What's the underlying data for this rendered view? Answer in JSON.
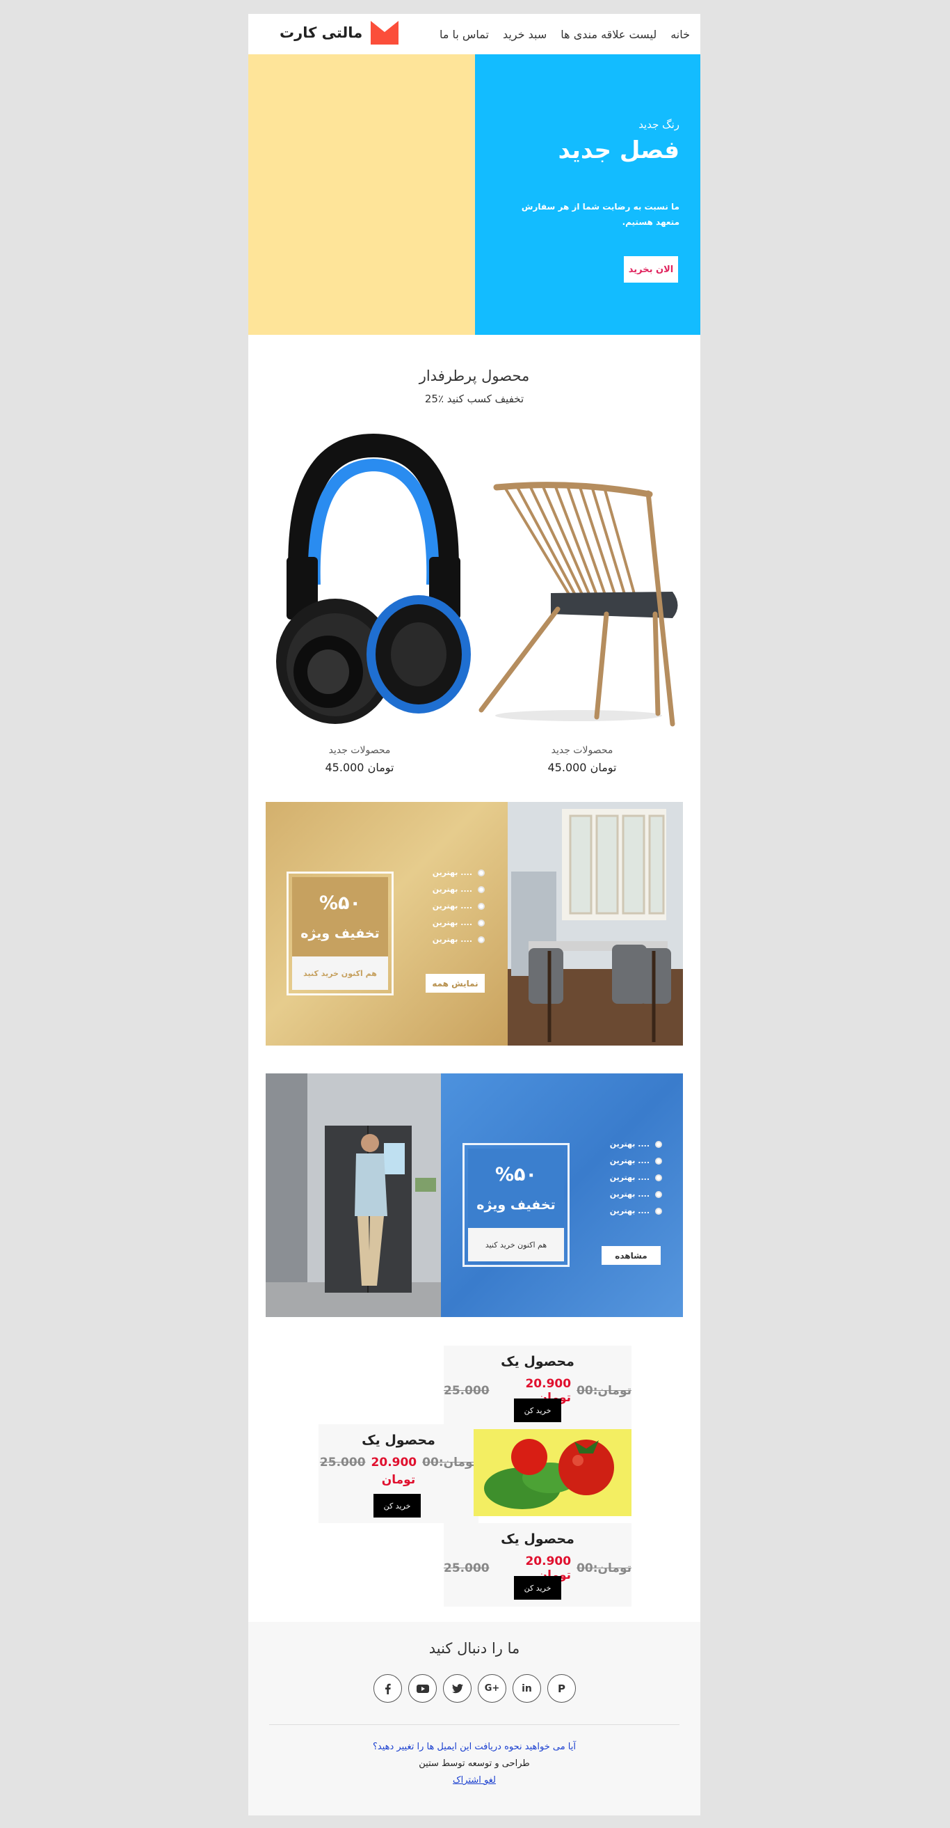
{
  "nav": {
    "items": [
      "خانه",
      "لیست علاقه مندی ها",
      "سبد خرید",
      "تماس با ما"
    ]
  },
  "brand": {
    "name": "مالتی کارت",
    "color": "#fb4e3a"
  },
  "hero": {
    "subtitle": "رنگ جدید",
    "title": "فصل جدید",
    "description": "ما نسبت به رضایت شما از هر سفارش متعهد هستیم.",
    "button": "الان بخرید",
    "left_color": "#fee499",
    "right_color": "#13bcff"
  },
  "featured": {
    "title": "محصول پرطرفدار",
    "subtitle": "25٪ تخفیف کسب کنید",
    "products": [
      {
        "image": "chair-image",
        "label": "محصولات جدید",
        "price": "45.000 تومان"
      },
      {
        "image": "headphones-image",
        "label": "محصولات جدید",
        "price": "45.000 تومان"
      }
    ]
  },
  "promo1": {
    "percent": "%۵۰",
    "off": "تخفیف ویژه",
    "cta": "هم اکنون خرید کنید",
    "bullets": [
      "بهترین ....",
      "بهترین ....",
      "بهترین ....",
      "بهترین ....",
      "بهترین ...."
    ],
    "button": "نمایش همه",
    "accent": "#c6a160"
  },
  "promo2": {
    "percent": "%۵۰",
    "off": "تخفیف ویژه",
    "cta": "هم اکنون خرید کنید",
    "bullets": [
      "بهترین ....",
      "بهترین ....",
      "بهترین ....",
      "بهترین ....",
      "بهترین ...."
    ],
    "button": "مشاهده",
    "accent": "#3b7fce"
  },
  "cards": [
    {
      "title": "محصول یک",
      "old_price": "25.000",
      "new_price": "20.900 تومان",
      "zero": "تومان:00",
      "button": "خرید کن"
    },
    {
      "title": "محصول یک",
      "old_price": "25.000",
      "new_price": "20.900",
      "unit": "تومان",
      "zero": "تومان:00",
      "button": "خرید کن"
    },
    {
      "title": "محصول یک",
      "old_price": "25.000",
      "new_price": "20.900 تومان",
      "zero": "تومان:00",
      "button": "خرید کن"
    }
  ],
  "footer": {
    "follow": "ما را دنبال کنید",
    "social_icons": [
      "facebook-icon",
      "youtube-icon",
      "twitter-icon",
      "google-plus-icon",
      "linkedin-icon",
      "pinterest-icon"
    ],
    "question": "آیا می خواهید نحوه دریافت این ایمیل ها را تغییر دهید؟",
    "credit": "طراحی و توسعه توسط ستین",
    "unsubscribe": "لغو اشتراک"
  }
}
